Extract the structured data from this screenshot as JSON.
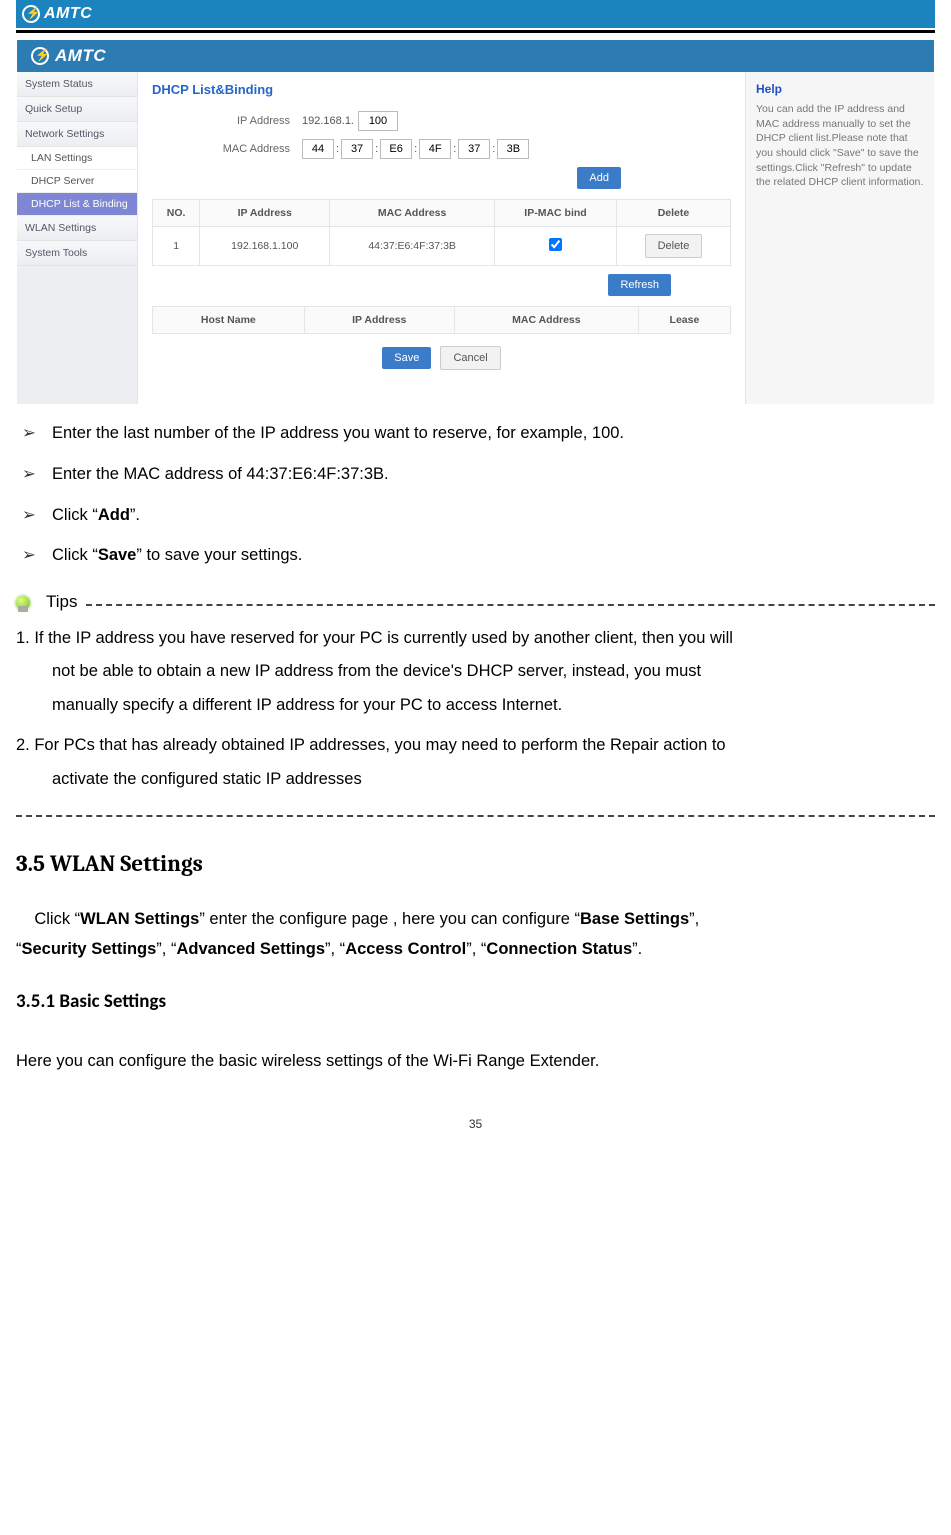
{
  "brand": "AMTC",
  "screenshot": {
    "header_logo": "AMTC",
    "sidebar": {
      "items": [
        "System Status",
        "Quick Setup",
        "Network Settings"
      ],
      "subs": [
        "LAN Settings",
        "DHCP Server",
        "DHCP List & Binding"
      ],
      "items2": [
        "WLAN Settings",
        "System Tools"
      ]
    },
    "panel": {
      "title": "DHCP List&Binding",
      "ip_label": "IP Address",
      "ip_prefix": "192.168.1.",
      "ip_value": "100",
      "mac_label": "MAC Address",
      "mac": [
        "44",
        "37",
        "E6",
        "4F",
        "37",
        "3B"
      ],
      "add": "Add",
      "table1": {
        "headers": [
          "NO.",
          "IP Address",
          "MAC Address",
          "IP-MAC bind",
          "Delete"
        ],
        "row": {
          "no": "1",
          "ip": "192.168.1.100",
          "mac": "44:37:E6:4F:37:3B"
        },
        "delete": "Delete"
      },
      "refresh": "Refresh",
      "table2": {
        "headers": [
          "Host Name",
          "IP Address",
          "MAC Address",
          "Lease"
        ]
      },
      "save": "Save",
      "cancel": "Cancel"
    },
    "help": {
      "title": "Help",
      "text": "You can add the IP address and MAC address manually to set the DHCP client list.Please note that you should click \"Save\" to save the settings.Click \"Refresh\" to update the related DHCP client information."
    }
  },
  "bullets": [
    "Enter the last number of the IP address you want to reserve, for example, 100.",
    "Enter the MAC address of 44:37:E6:4F:37:3B."
  ],
  "bullet_add_pre": "Click “",
  "bullet_add_b": "Add",
  "bullet_add_post": "”.",
  "bullet_save_pre": "Click “",
  "bullet_save_b": "Save",
  "bullet_save_post": "” to save your settings.",
  "tips_label": "Tips",
  "tip1_a": "1. If the IP address you have reserved for your PC is currently used by another client, then you will",
  "tip1_b": "not be able to obtain a new IP address from the device's DHCP server, instead, you must",
  "tip1_c": "manually specify a different IP address for your PC to access Internet.",
  "tip2_a": "2. For PCs that has already obtained IP addresses, you may need to perform the Repair action to",
  "tip2_b": "activate the configured static IP addresses",
  "sec_heading": "3.5 WLAN Settings",
  "wlan_p1_a": "Click “",
  "wlan_p1_b": "WLAN Settings",
  "wlan_p1_c": "” enter the configure page , here you can configure “",
  "wlan_p1_d": "Base Settings",
  "wlan_p1_e": "”,",
  "wlan_p2_a": "“",
  "wlan_p2_b": "Security Settings",
  "wlan_p2_c": "”, “",
  "wlan_p2_d": "Advanced Settings",
  "wlan_p2_e": "”, “",
  "wlan_p2_f": "Access Control",
  "wlan_p2_g": "”, “",
  "wlan_p2_h": "Connection Status",
  "wlan_p2_i": "”.",
  "sub_heading": "3.5.1 Basic Settings",
  "basic_text": "Here you can configure the basic wireless settings of the Wi-Fi Range Extender.",
  "page_number": "35"
}
